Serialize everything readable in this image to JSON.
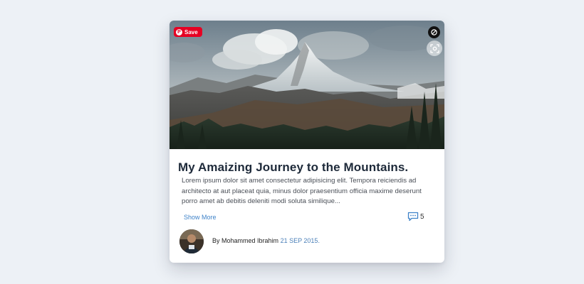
{
  "card": {
    "save_label": "Save",
    "title": "My Amaizing Journey to the Mountains.",
    "body": "Lorem ipsum dolor sit amet consectetur adipisicing elit. Tempora reiciendis ad architecto at aut placeat quia, minus dolor praesentium officia maxime deserunt porro amet ab debitis deleniti modi soluta similique...",
    "show_more_label": "Show More",
    "comment_count": "5",
    "author": "By Mohammed Ibrahim",
    "date": "21 SEP 2015."
  },
  "icons": {
    "save": "pinterest-icon",
    "top_right": "share-icon",
    "lens": "visual-search-icon",
    "comments": "comment-icon"
  },
  "colors": {
    "background": "#edf1f6",
    "save_red": "#e60023",
    "link_blue": "#3f83c9",
    "title": "#1e2a3a"
  }
}
